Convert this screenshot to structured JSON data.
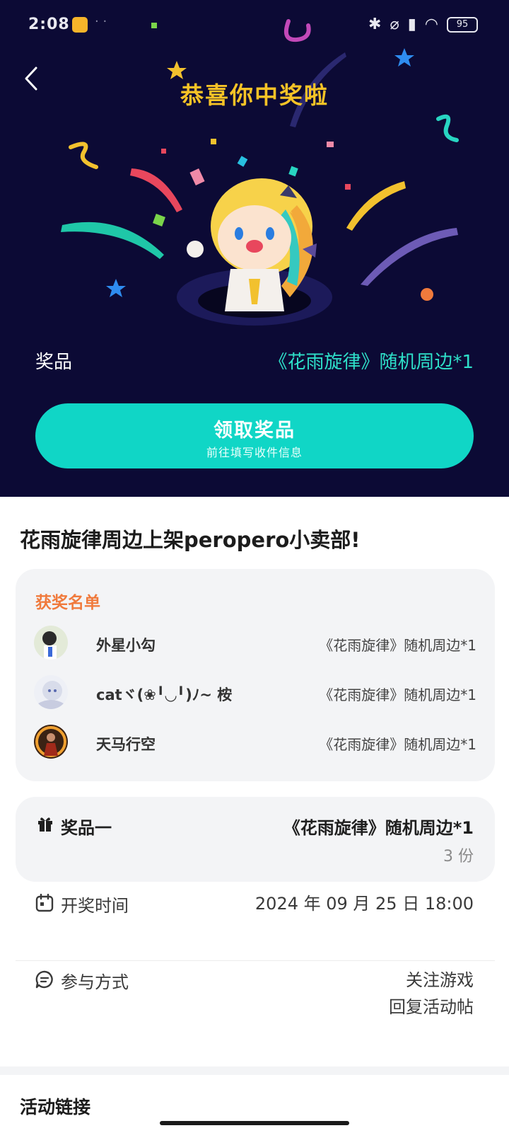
{
  "status_bar": {
    "time": "2:08",
    "dots": "· ·",
    "battery": "95"
  },
  "hero": {
    "title": "恭喜你中奖啦",
    "prize_label": "奖品",
    "prize_value": "《花雨旋律》随机周边*1",
    "claim_button": {
      "label": "领取奖品",
      "sublabel": "前往填写收件信息"
    },
    "colors": {
      "background": "#0c0a35",
      "title": "#f7c326",
      "accent": "#10d6c6"
    }
  },
  "post": {
    "title": "花雨旋律周边上架peropero小卖部!"
  },
  "winners": {
    "title": "获奖名单",
    "list": [
      {
        "name": "外星小勾",
        "prize": "《花雨旋律》随机周边*1",
        "avatar": "avatar-icon"
      },
      {
        "name": "catヾ(❀╹◡╹)ﾉ~ 桉",
        "prize": "《花雨旋律》随机周边*1",
        "avatar": "avatar-icon"
      },
      {
        "name": "天马行空",
        "prize": "《花雨旋律》随机周边*1",
        "avatar": "avatar-icon"
      }
    ]
  },
  "prize_detail": {
    "label": "奖品一",
    "name": "《花雨旋律》随机周边*1",
    "count": "3 份"
  },
  "draw_time": {
    "label": "开奖时间",
    "value": "2024 年 09 月 25 日 18:00"
  },
  "participation": {
    "label": "参与方式",
    "methods": [
      "关注游戏",
      "回复活动帖"
    ]
  },
  "links": {
    "title": "活动链接"
  }
}
